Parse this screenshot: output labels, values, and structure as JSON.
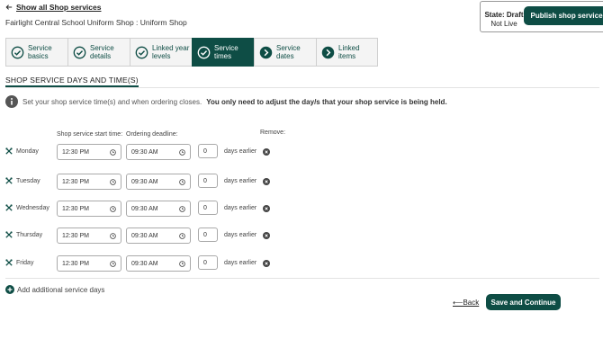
{
  "nav": {
    "back_label": "Show all Shop services"
  },
  "shop": {
    "title": "Fairlight Central School Uniform Shop : Uniform Shop"
  },
  "status": {
    "label": "State: Draft",
    "sub": "Not Live",
    "publish_label": "Publish shop service"
  },
  "steps": [
    {
      "label": "Service basics",
      "state": "done"
    },
    {
      "label": "Service details",
      "state": "done"
    },
    {
      "label": "Linked year levels",
      "state": "done"
    },
    {
      "label": "Service times",
      "state": "active"
    },
    {
      "label": "Service dates",
      "state": "future"
    },
    {
      "label": "Linked items",
      "state": "future"
    }
  ],
  "section": {
    "heading": "SHOP SERVICE DAYS AND TIME(S)",
    "info_text": "Set your shop service time(s) and when ordering closes.",
    "info_bold": "You only need to adjust the day/s that your shop service is being held."
  },
  "columns": {
    "start": "Shop service start time:",
    "deadline": "Ordering deadline:",
    "remove": "Remove:"
  },
  "rows": [
    {
      "day": "Monday",
      "start": "12:30 PM",
      "deadline": "09:30 AM",
      "days": "0",
      "days_label": "days earlier"
    },
    {
      "day": "Tuesday",
      "start": "12:30 PM",
      "deadline": "09:30 AM",
      "days": "0",
      "days_label": "days earlier"
    },
    {
      "day": "Wednesday",
      "start": "12:30 PM",
      "deadline": "09:30 AM",
      "days": "0",
      "days_label": "days earlier"
    },
    {
      "day": "Thursday",
      "start": "12:30 PM",
      "deadline": "09:30 AM",
      "days": "0",
      "days_label": "days earlier"
    },
    {
      "day": "Friday",
      "start": "12:30 PM",
      "deadline": "09:30 AM",
      "days": "0",
      "days_label": "days earlier"
    }
  ],
  "actions": {
    "add_days": "Add additional service days",
    "back": "Back",
    "save": "Save and Continue"
  },
  "colors": {
    "brand": "#0e4d45",
    "step_bg": "#f4f4f4"
  }
}
